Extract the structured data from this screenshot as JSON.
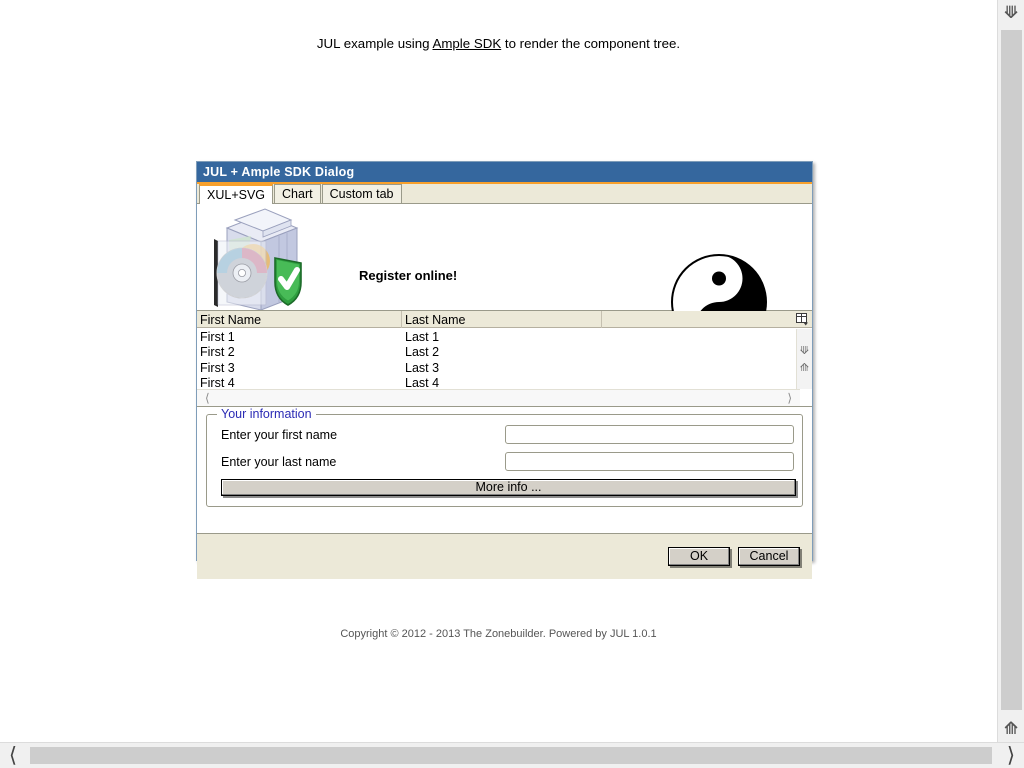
{
  "page": {
    "header_prefix": "JUL example using ",
    "header_link": "Ample SDK",
    "header_suffix": " to render the component tree.",
    "footer": "Copyright © 2012 - 2013 The Zonebuilder. Powered by JUL 1.0.1"
  },
  "dialog": {
    "title": "JUL + Ample SDK Dialog",
    "title_bar_color": "#35679e",
    "accent_color": "#f7a02c",
    "tabs": [
      {
        "label": "XUL+SVG",
        "selected": true
      },
      {
        "label": "Chart",
        "selected": false
      },
      {
        "label": "Custom tab",
        "selected": false
      }
    ],
    "banner": {
      "register_label": "Register online!",
      "box_icon_name": "software-box-icon",
      "yinyang_icon_name": "yin-yang-icon"
    },
    "grid": {
      "columns": [
        "First Name",
        "Last Name",
        ""
      ],
      "rows": [
        {
          "first": "First 1",
          "last": "Last 1",
          "extra": ""
        },
        {
          "first": "First 2",
          "last": "Last 2",
          "extra": ""
        },
        {
          "first": "First 3",
          "last": "Last 3",
          "extra": ""
        },
        {
          "first": "First 4",
          "last": "Last 4",
          "extra": ""
        }
      ]
    },
    "form": {
      "legend": "Your information",
      "legend_color": "#2b2bb5",
      "first_name_label": "Enter your first name",
      "first_name_value": "",
      "first_name_placeholder": "",
      "last_name_label": "Enter your last name",
      "last_name_value": "",
      "last_name_placeholder": "",
      "more_info_label": "More info ..."
    },
    "buttons": {
      "ok": "OK",
      "cancel": "Cancel"
    }
  },
  "scrollbars": {
    "up_icon": "chevron-up-icon",
    "down_icon": "chevron-down-icon",
    "left_icon": "chevron-left-icon",
    "right_icon": "chevron-right-icon"
  }
}
